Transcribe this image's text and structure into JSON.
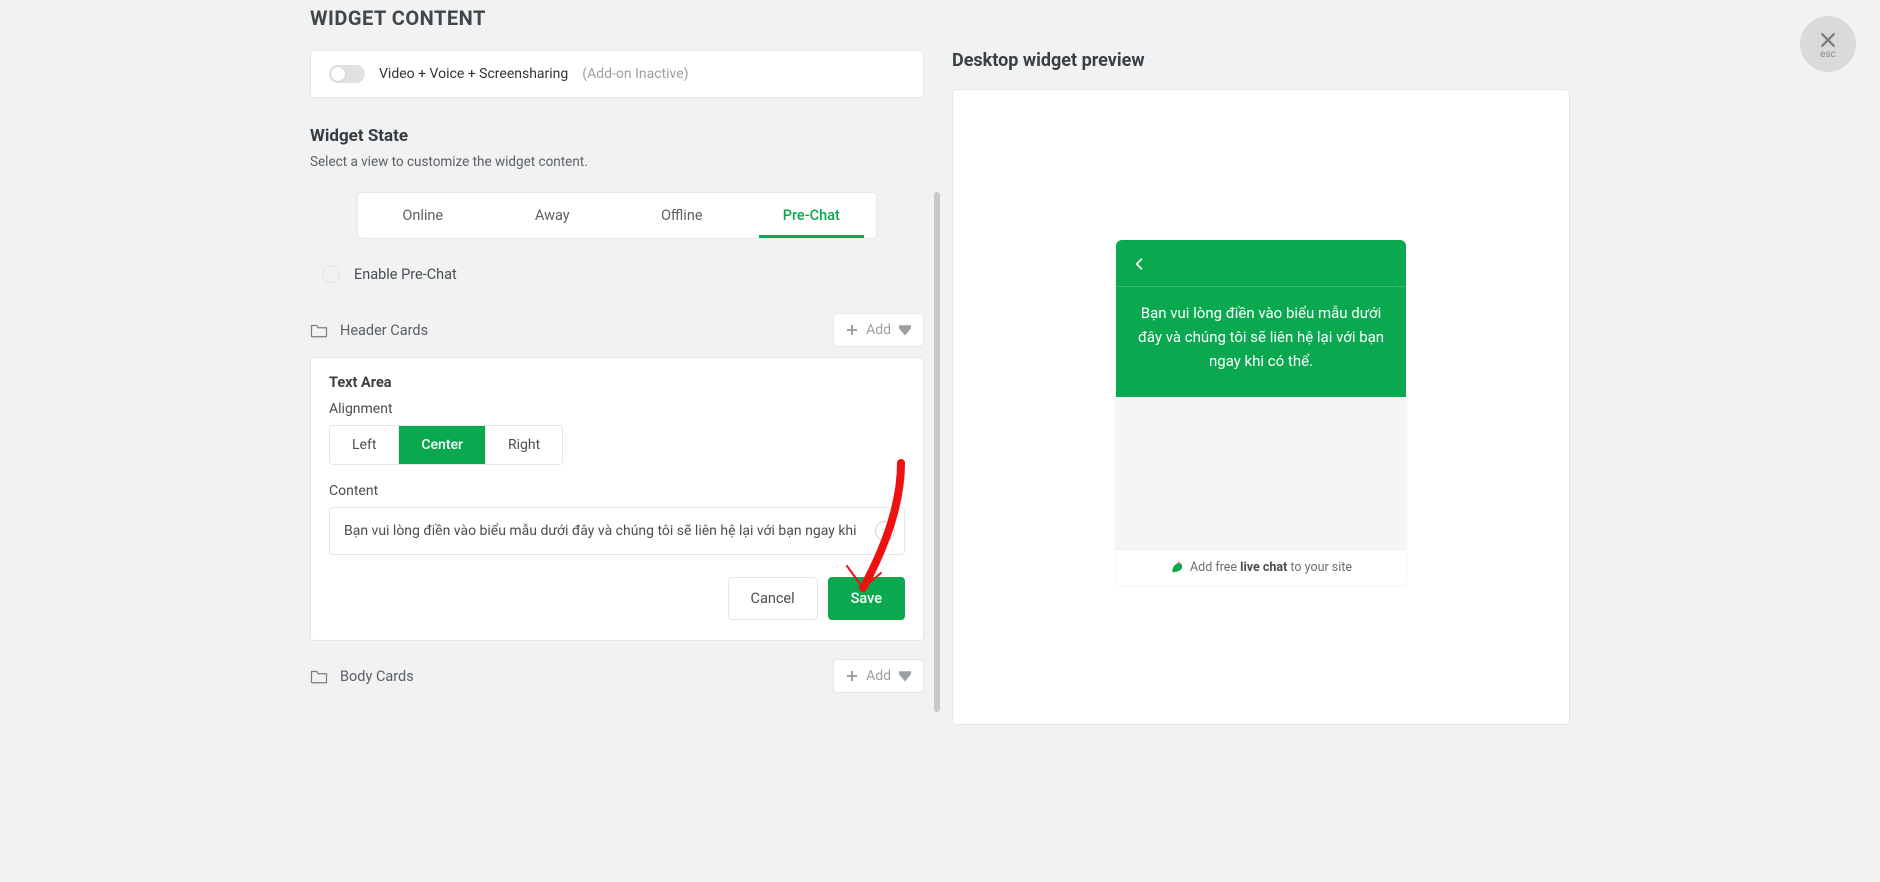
{
  "close": {
    "esc": "esc"
  },
  "title": "WIDGET CONTENT",
  "addon": {
    "label": "Video + Voice + Screensharing",
    "inactive": "(Add-on Inactive)"
  },
  "widgetState": {
    "heading": "Widget State",
    "sub": "Select a view to customize the widget content.",
    "tabs": {
      "online": "Online",
      "away": "Away",
      "offline": "Offline",
      "prechat": "Pre-Chat"
    },
    "enable": "Enable Pre-Chat"
  },
  "headerCards": {
    "label": "Header Cards",
    "add": "Add"
  },
  "textArea": {
    "title": "Text Area",
    "alignmentLabel": "Alignment",
    "align": {
      "left": "Left",
      "center": "Center",
      "right": "Right"
    },
    "contentLabel": "Content",
    "contentValue": "Bạn vui lòng điền vào biểu mẫu dưới đây và chúng tôi sẽ liên hệ lại với bạn ngay khi có thể.",
    "cancel": "Cancel",
    "save": "Save"
  },
  "bodyCards": {
    "label": "Body Cards",
    "add": "Add"
  },
  "preview": {
    "title": "Desktop widget preview",
    "message": "Bạn vui lòng điền vào biểu mẫu dưới đây và chúng tôi sẽ liên hệ lại với bạn ngay khi có thể.",
    "footerPre": "Add free ",
    "footerBold": "live chat",
    "footerPost": " to your site"
  }
}
